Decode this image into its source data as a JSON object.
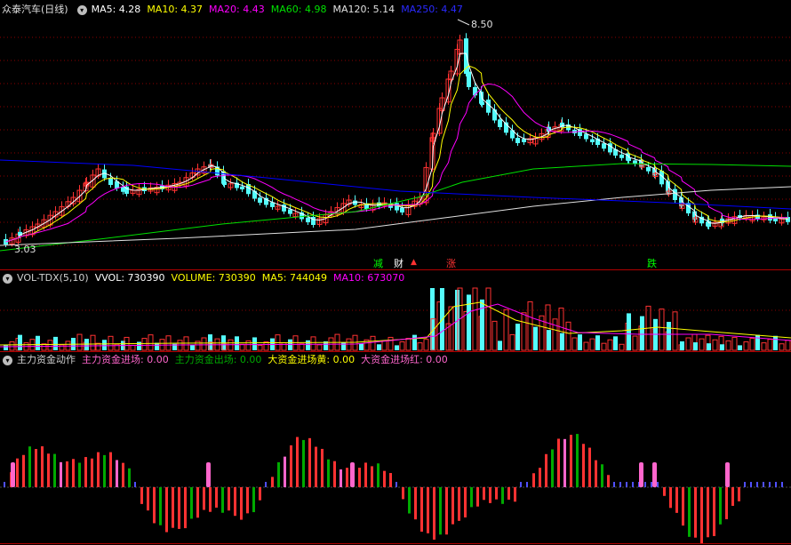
{
  "colors": {
    "up": "#ff3232",
    "down": "#54fcfc",
    "ma5": "#ffffff",
    "ma10": "#ffff00",
    "ma20": "#ff00ff",
    "ma60": "#00e000",
    "ma120": "#e0e0e0",
    "ma250": "#0000ff",
    "grid": "#8b0000",
    "vol_ma5": "#ffff00",
    "vol_ma10": "#ff00ff",
    "inflow": "#ff3232",
    "outflow": "#00aa00",
    "big_yellow": "#ffff00",
    "big_red": "#ff66cc"
  },
  "icons": {
    "collapse": "collapse-toggle-icon",
    "up_arrow": "up-triangle-icon"
  },
  "price_panel": {
    "stock_name": "众泰汽车(日线)",
    "ma": [
      {
        "label": "MA5: 4.28",
        "color": "#ffffff"
      },
      {
        "label": "MA10: 4.37",
        "color": "#ffff00"
      },
      {
        "label": "MA20: 4.43",
        "color": "#ff00ff"
      },
      {
        "label": "MA60: 4.98",
        "color": "#00e000"
      },
      {
        "label": "MA120: 5.14",
        "color": "#e0e0e0"
      },
      {
        "label": "MA250: 4.47",
        "color": "#2a2aff"
      }
    ],
    "high_label": "8.50",
    "low_label": "3.03",
    "signals": [
      {
        "text": "减",
        "color": "#00ff00"
      },
      {
        "text": "财",
        "color": "#ffffff"
      },
      {
        "text": "涨",
        "color": "#ff3232"
      },
      {
        "text": "跌",
        "color": "#00ff00"
      }
    ]
  },
  "volume_panel": {
    "indicator": "VOL-TDX(5,10)",
    "vvol": "VVOL: 730390",
    "volume": "VOLUME: 730390",
    "ma5": "MA5: 744049",
    "ma10": "MA10: 673070"
  },
  "fund_panel": {
    "indicator": "主力资金动作",
    "main_in": "主力资金进场: 0.00",
    "main_out": "主力资金出场: 0.00",
    "big_yellow": "大资金进场黄: 0.00",
    "big_red": "大资金进场红: 0.00"
  }
}
